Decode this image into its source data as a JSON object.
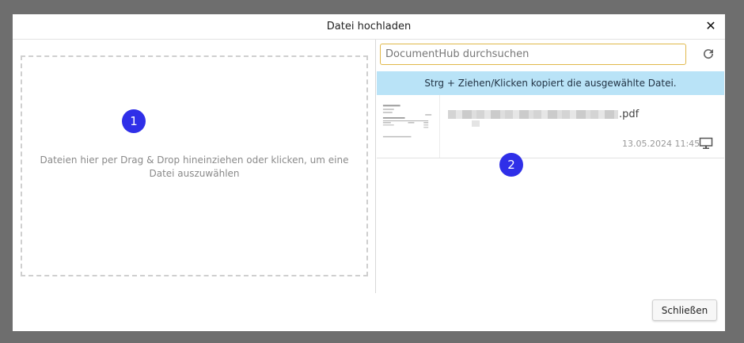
{
  "dialog": {
    "title": "Datei hochladen",
    "close_glyph": "✕"
  },
  "dropzone": {
    "text": "Dateien hier per Drag & Drop hineinziehen oder klicken, um eine Datei auszuwählen"
  },
  "markers": [
    "1",
    "2"
  ],
  "search": {
    "placeholder": "DocumentHub durchsuchen",
    "value": ""
  },
  "info_bar": {
    "text": "Strg + Ziehen/Klicken kopiert die ausgewählte Datei."
  },
  "files": [
    {
      "name_suffix": ".pdf",
      "date": "13.05.2024 11:45",
      "icon": "desktop-icon"
    }
  ],
  "footer": {
    "close_label": "Schließen"
  },
  "colors": {
    "marker": "#2f2fe8",
    "info_bar": "#b9e3f7",
    "search_border": "#e0b84a"
  }
}
